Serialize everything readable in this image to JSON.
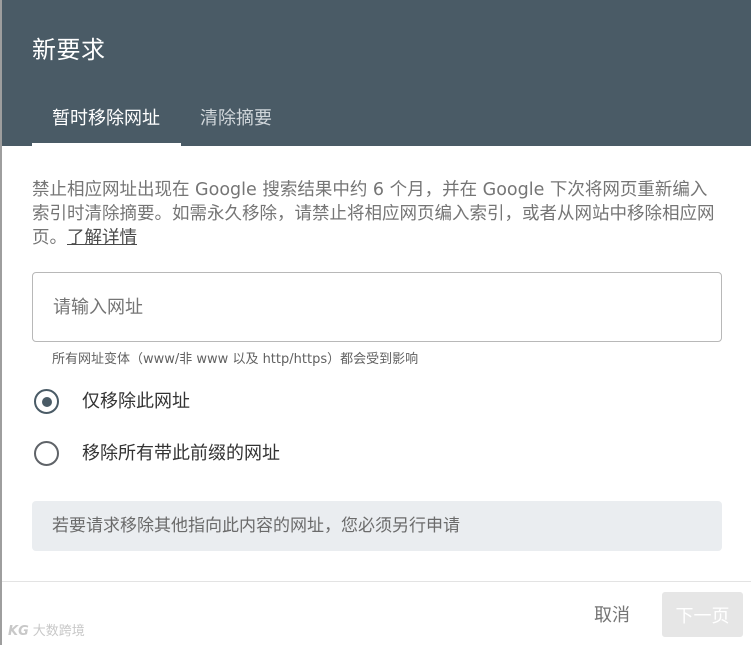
{
  "dialog": {
    "title": "新要求",
    "tabs": [
      {
        "label": "暂时移除网址",
        "active": true
      },
      {
        "label": "清除摘要",
        "active": false
      }
    ],
    "description": {
      "text": "禁止相应网址出现在 Google 搜索结果中约 6 个月，并在 Google 下次将网页重新编入索引时清除摘要。如需永久移除，请禁止将相应网页编入索引，或者从网站中移除相应网页。",
      "link": "了解详情"
    },
    "url_input": {
      "placeholder": "请输入网址",
      "value": ""
    },
    "hint": "所有网址变体（www/非 www 以及 http/https）都会受到影响",
    "radio_options": [
      {
        "label": "仅移除此网址",
        "selected": true
      },
      {
        "label": "移除所有带此前缀的网址",
        "selected": false
      }
    ],
    "note": "若要请求移除其他指向此内容的网址，您必须另行申请",
    "footer": {
      "cancel_label": "取消",
      "next_label": "下一页"
    }
  },
  "watermark": {
    "logo": "KG",
    "text": "大数跨境"
  },
  "colors": {
    "header_bg": "#4a5b66",
    "radio_accent": "#4a5b66",
    "note_bg": "#eaedf0",
    "disabled_button_bg": "#e6e6e6"
  }
}
